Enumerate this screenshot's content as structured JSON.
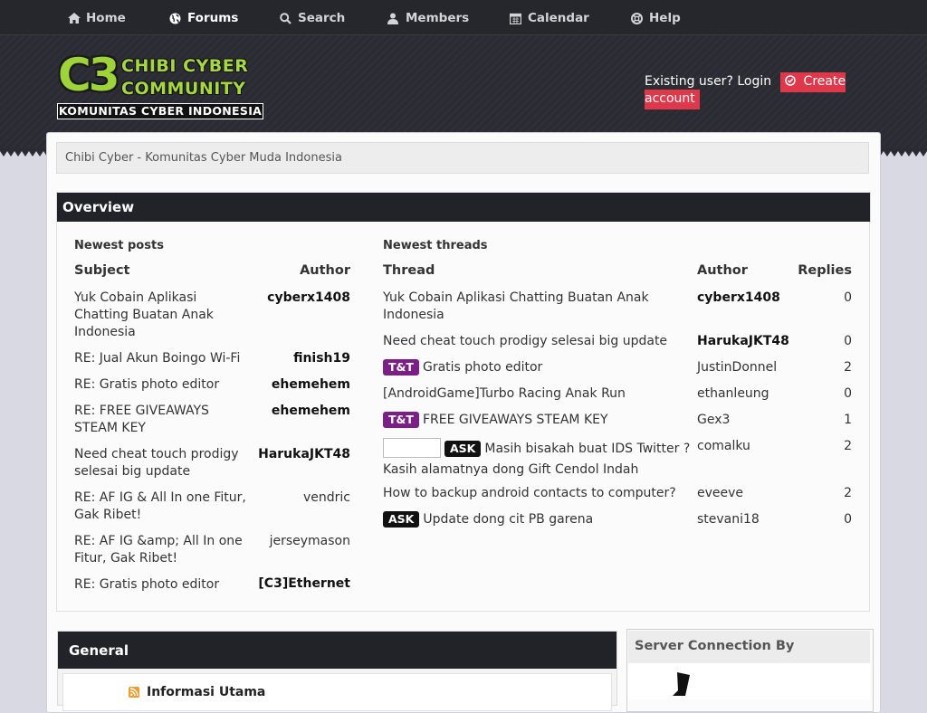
{
  "nav": {
    "items": [
      {
        "label": "Home",
        "icon": "home-icon"
      },
      {
        "label": "Forums",
        "icon": "globe-icon",
        "active": true
      },
      {
        "label": "Search",
        "icon": "search-icon"
      },
      {
        "label": "Members",
        "icon": "user-icon"
      },
      {
        "label": "Calendar",
        "icon": "calendar-icon"
      },
      {
        "label": "Help",
        "icon": "lifebuoy-icon"
      }
    ]
  },
  "logo": {
    "mark": "C3",
    "line1": "CHIBI CYBER",
    "line2": "COMMUNITY",
    "tagline": "KOMUNITAS CYBER INDONESIA"
  },
  "login": {
    "existing_label": "Existing user? Login",
    "create_label": "Create account",
    "create_icon": "check-circle-icon"
  },
  "breadcrumb": {
    "text": "Chibi Cyber - Komunitas Cyber Muda Indonesia"
  },
  "overview": {
    "title": "Overview",
    "newest_posts": {
      "heading": "Newest posts",
      "col_subject": "Subject",
      "col_author": "Author",
      "rows": [
        {
          "subject": "Yuk Cobain Aplikasi Chatting Buatan Anak Indonesia",
          "author": "cyberx1408",
          "bold": true
        },
        {
          "subject": "RE: Jual Akun Boingo Wi-Fi",
          "author": "finish19",
          "bold": true
        },
        {
          "subject": "RE: Gratis photo editor",
          "author": "ehemehem",
          "bold": true
        },
        {
          "subject": "RE: FREE GIVEAWAYS STEAM KEY",
          "author": "ehemehem",
          "bold": true
        },
        {
          "subject": "Need cheat touch prodigy selesai big update",
          "author": "HarukaJKT48",
          "bold": true
        },
        {
          "subject": "RE: AF IG & All In one Fitur, Gak Ribet!",
          "author": "vendric",
          "bold": false
        },
        {
          "subject": "RE: AF IG &amp; All In one Fitur, Gak Ribet!",
          "author": "jerseymason",
          "bold": false
        },
        {
          "subject": "RE: Gratis photo editor",
          "author": "[C3]Ethernet",
          "bold": true
        }
      ]
    },
    "newest_threads": {
      "heading": "Newest threads",
      "col_thread": "Thread",
      "col_author": "Author",
      "col_replies": "Replies",
      "rows": [
        {
          "prefix": "",
          "title": "Yuk Cobain Aplikasi Chatting Buatan Anak Indonesia",
          "author": "cyberx1408",
          "bold": true,
          "replies": "0"
        },
        {
          "prefix": "",
          "title": "Need cheat touch prodigy selesai big update",
          "author": "HarukaJKT48",
          "bold": true,
          "replies": "0"
        },
        {
          "prefix": "T&T",
          "title": "Gratis photo editor",
          "author": "JustinDonnel",
          "bold": false,
          "replies": "2"
        },
        {
          "prefix": "",
          "title": "[AndroidGame]Turbo Racing Anak Run",
          "author": "ethanleung",
          "bold": false,
          "replies": "0"
        },
        {
          "prefix": "T&T",
          "title": "FREE GIVEAWAYS STEAM KEY",
          "author": "Gex3",
          "bold": false,
          "replies": "1"
        },
        {
          "prefix": "ASK",
          "title": "Masih bisakah buat IDS Twitter ? Kasih alamatnya dong Gift Cendol Indah",
          "author": "comalku",
          "bold": false,
          "replies": "2"
        },
        {
          "prefix": "",
          "title": "How to backup android contacts to computer?",
          "author": "eveeve",
          "bold": false,
          "replies": "2"
        },
        {
          "prefix": "ASK",
          "title": "Update dong cit PB garena",
          "author": "stevani18",
          "bold": false,
          "replies": "0"
        }
      ]
    }
  },
  "general": {
    "title": "General",
    "forum_name": "Informasi Utama",
    "forum_icon": "rss-icon"
  },
  "server": {
    "title": "Server Connection By"
  },
  "colors": {
    "nav_bg": "#26272c",
    "header_bg": "#2b2c33",
    "accent_red": "#e0384b",
    "prefix_tt": "#7b1f86",
    "prefix_ask": "#111111",
    "logo_green": "#9ed43a"
  }
}
